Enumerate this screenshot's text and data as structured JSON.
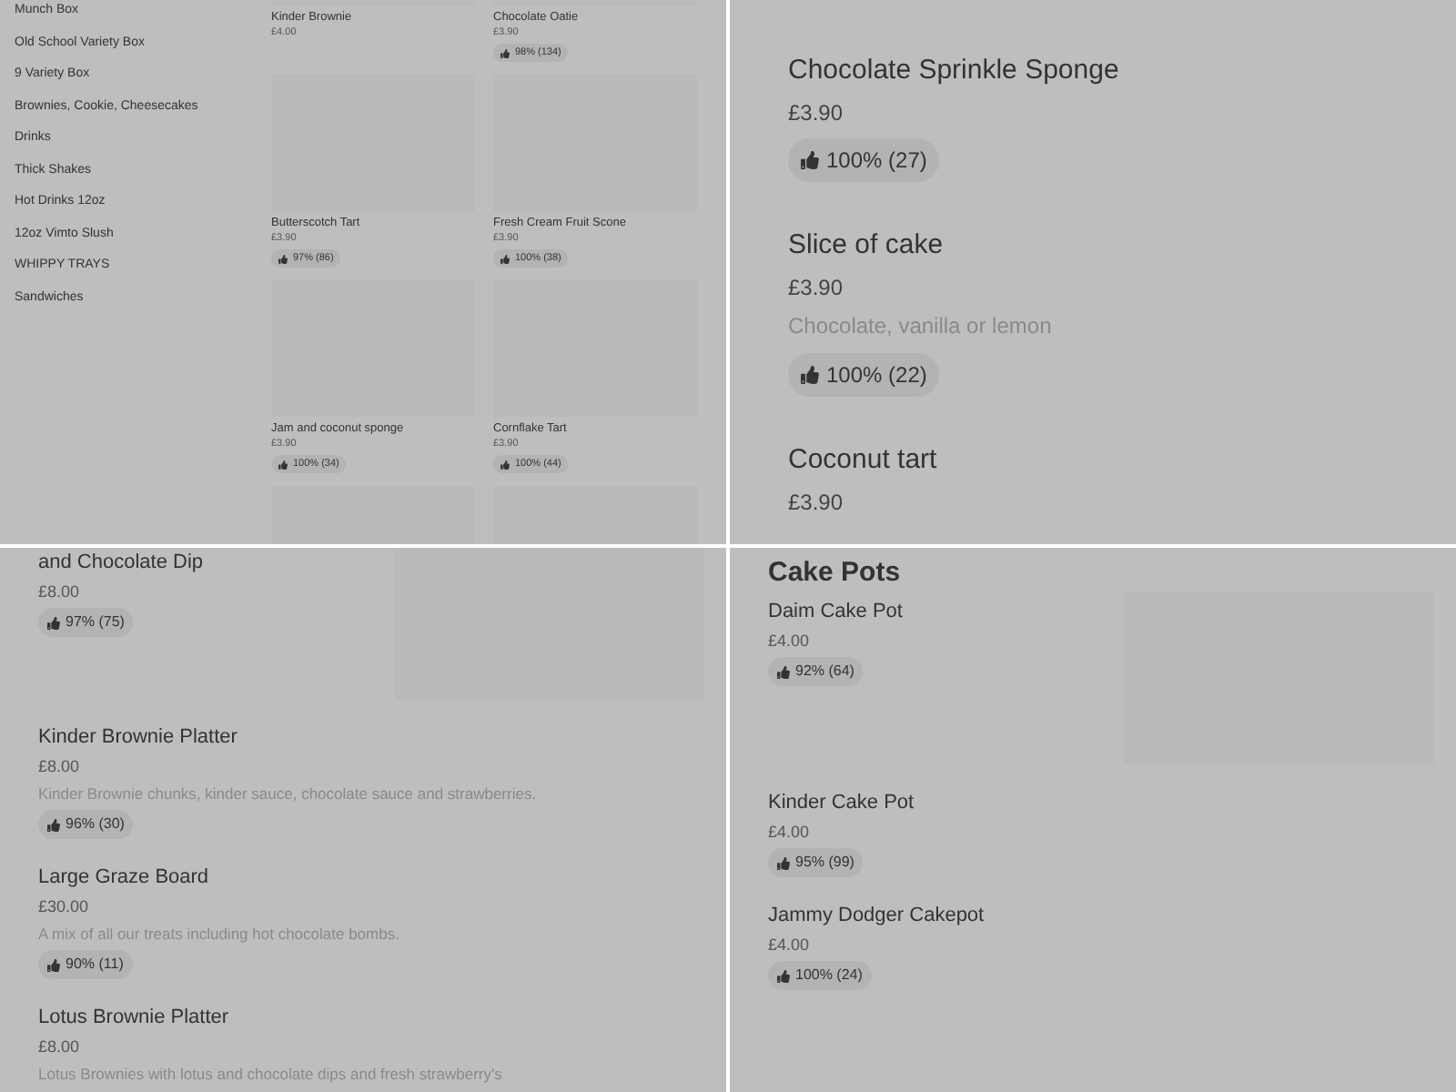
{
  "panels": [
    {
      "kind": "grid",
      "categories": [
        "Munch Box",
        "Old School Variety Box",
        "9 Variety Box",
        "Brownies, Cookie, Cheesecakes",
        "Drinks",
        "Thick Shakes",
        "Hot Drinks 12oz",
        "12oz Vimto Slush",
        "WHIPPY TRAYS",
        "Sandwiches"
      ],
      "products": [
        {
          "name": "Kinder Brownie",
          "price": "£4.00"
        },
        {
          "name": "Chocolate Oatie",
          "price": "£3.90",
          "rating": "98% (134)"
        },
        {
          "name": "Butterscotch Tart",
          "price": "£3.90",
          "rating": "97% (86)"
        },
        {
          "name": "Fresh Cream Fruit Scone",
          "price": "£3.90",
          "rating": "100% (38)"
        },
        {
          "name": "Jam and coconut sponge",
          "price": "£3.90",
          "rating": "100% (34)"
        },
        {
          "name": "Cornflake Tart",
          "price": "£3.90",
          "rating": "100% (44)"
        }
      ]
    },
    {
      "kind": "large_list",
      "items": [
        {
          "name": "Chocolate Sprinkle Sponge",
          "price": "£3.90",
          "rating": "100% (27)"
        },
        {
          "name": "Slice of cake",
          "price": "£3.90",
          "description": "Chocolate, vanilla or lemon",
          "rating": "100% (22)"
        },
        {
          "name": "Coconut tart",
          "price": "£3.90"
        }
      ]
    },
    {
      "kind": "list",
      "items": [
        {
          "name": "and Chocolate Dip",
          "price": "£8.00",
          "rating": "97% (75)",
          "photo": true
        },
        {
          "name": "Kinder Brownie Platter",
          "price": "£8.00",
          "description": "Kinder Brownie chunks, kinder sauce, chocolate sauce and strawberries.",
          "rating": "96% (30)",
          "photo": false
        },
        {
          "name": "Large Graze Board",
          "price": "£30.00",
          "description": "A mix of all our treats including hot chocolate bombs.",
          "rating": "90% (11)",
          "photo": false
        },
        {
          "name": "Lotus Brownie Platter",
          "price": "£8.00",
          "description": "Lotus Brownies with lotus and chocolate dips and fresh strawberry's",
          "photo": false
        }
      ]
    },
    {
      "kind": "list",
      "heading": "Cake Pots",
      "items": [
        {
          "name": "Daim Cake Pot",
          "price": "£4.00",
          "rating": "92% (64)",
          "photo": true
        },
        {
          "name": "Kinder Cake Pot",
          "price": "£4.00",
          "rating": "95% (99)",
          "photo": false
        },
        {
          "name": "Jammy Dodger Cakepot",
          "price": "£4.00",
          "rating": "100% (24)",
          "photo": false
        }
      ]
    }
  ]
}
